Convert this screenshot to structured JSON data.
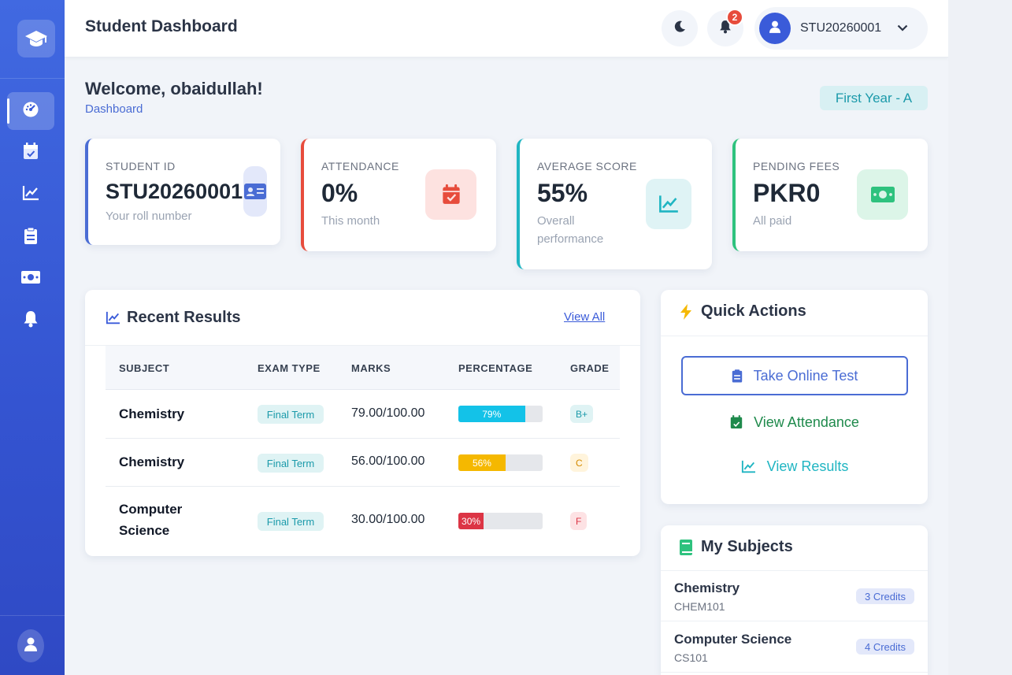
{
  "app": {
    "page_title": "Student Dashboard"
  },
  "header": {
    "theme_icon": "moon-icon",
    "notification_count": "2",
    "user_id": "STU20260001"
  },
  "sidebar": {
    "items": [
      {
        "icon": "dashboard-gauge-icon",
        "active": true
      },
      {
        "icon": "calendar-check-icon",
        "active": false
      },
      {
        "icon": "chart-line-icon",
        "active": false
      },
      {
        "icon": "clipboard-list-icon",
        "active": false
      },
      {
        "icon": "money-bill-icon",
        "active": false
      },
      {
        "icon": "bell-icon",
        "active": false
      }
    ]
  },
  "welcome": {
    "greeting": "Welcome, obaidullah!",
    "breadcrumb": "Dashboard",
    "class_badge": "First Year - A"
  },
  "stats": [
    {
      "label": "STUDENT ID",
      "value": "STU20260001",
      "sub": "Your roll number",
      "accent": "#4a6cd4"
    },
    {
      "label": "ATTENDANCE",
      "value": "0%",
      "sub": "This month",
      "accent": "#e74c3c"
    },
    {
      "label": "AVERAGE SCORE",
      "value": "55%",
      "sub": "Overall performance",
      "accent": "#1fb5c2"
    },
    {
      "label": "PENDING FEES",
      "value": "PKR0",
      "sub": "All paid",
      "accent": "#2ec27e"
    }
  ],
  "results": {
    "title": "Recent Results",
    "view_all": "View All",
    "columns": [
      "SUBJECT",
      "EXAM TYPE",
      "MARKS",
      "PERCENTAGE",
      "GRADE"
    ],
    "rows": [
      {
        "subject": "Chemistry",
        "exam_type": "Final Term",
        "marks": "79.00/100.00",
        "percentage": "79%",
        "percent_value": 79,
        "bar_color": "#13c2e8",
        "grade": "B+",
        "grade_bg": "#dff3f4",
        "grade_color": "#1b9aaa"
      },
      {
        "subject": "Chemistry",
        "exam_type": "Final Term",
        "marks": "56.00/100.00",
        "percentage": "56%",
        "percent_value": 56,
        "bar_color": "#f5b800",
        "grade": "C",
        "grade_bg": "#fff4dc",
        "grade_color": "#d48a00"
      },
      {
        "subject": "Computer Science",
        "exam_type": "Final Term",
        "marks": "30.00/100.00",
        "percentage": "30%",
        "percent_value": 30,
        "bar_color": "#dc3545",
        "grade": "F",
        "grade_bg": "#fde2e4",
        "grade_color": "#dc3545"
      }
    ]
  },
  "quick_actions": {
    "title": "Quick Actions",
    "take_test": "Take Online Test",
    "view_attendance": "View Attendance",
    "view_results": "View Results"
  },
  "subjects": {
    "title": "My Subjects",
    "items": [
      {
        "name": "Chemistry",
        "code": "CHEM101",
        "credits": "3 Credits"
      },
      {
        "name": "Computer Science",
        "code": "CS101",
        "credits": "4 Credits"
      }
    ]
  }
}
